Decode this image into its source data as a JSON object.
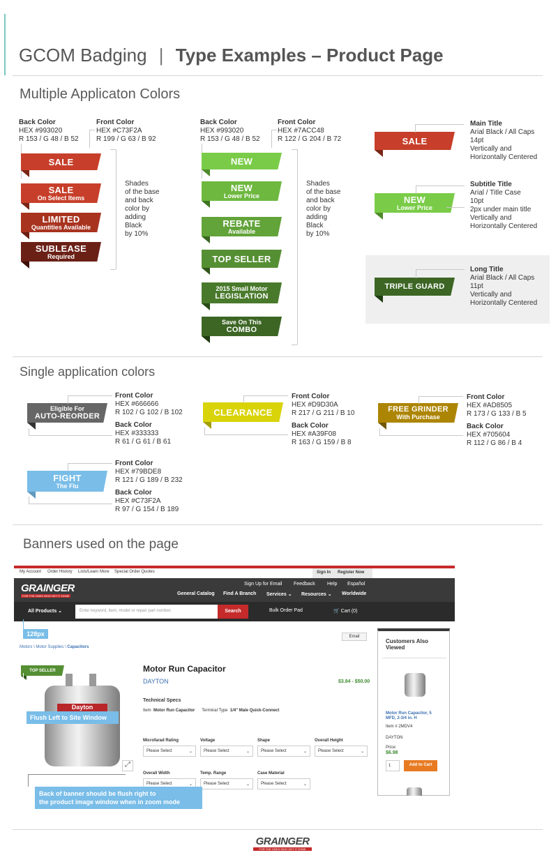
{
  "header": {
    "brand": "GCOM Badging",
    "divider": "|",
    "title": "Type Examples – Product Page"
  },
  "section1": {
    "title": "Multiple Applicaton Colors",
    "red": {
      "back": {
        "label": "Back Color",
        "hex": "HEX #993020",
        "rgb": "R 153 / G 48 / B 52"
      },
      "front": {
        "label": "Front Color",
        "hex": "HEX #C73F2A",
        "rgb": "R 199 / G 63 / B 92"
      },
      "shades": [
        "Shades",
        "of the base",
        "and back",
        "color by",
        "adding",
        "Black",
        "by 10%"
      ],
      "badges": [
        {
          "t1": "SALE",
          "t2": ""
        },
        {
          "t1": "SALE",
          "t2": "On Select Items"
        },
        {
          "t1": "LIMITED",
          "t2": "Quantities Available"
        },
        {
          "t1": "SUBLEASE",
          "t2": "Required"
        }
      ]
    },
    "green": {
      "back": {
        "label": "Back Color",
        "hex": "HEX #993020",
        "rgb": "R 153 / G 48 / B 52"
      },
      "front": {
        "label": "Front Color",
        "hex": "HEX #7ACC48",
        "rgb": "R 122 / G 204 / B 72"
      },
      "shades": [
        "Shades",
        "of the base",
        "and back",
        "color by",
        "adding",
        "Black",
        "by 10%"
      ],
      "badges": [
        {
          "t1": "NEW",
          "t2": ""
        },
        {
          "t1": "NEW",
          "t2": "Lower Price"
        },
        {
          "t1": "REBATE",
          "t2": "Available"
        },
        {
          "t1": "TOP SELLER",
          "t2": ""
        },
        {
          "t1": "LEGISLATION",
          "t2": "2015 Small Motor"
        },
        {
          "t1": "COMBO",
          "t2": "Save On This"
        }
      ]
    },
    "specs": {
      "main": {
        "badge": "SALE",
        "title": "Main Title",
        "lines": [
          "Arial Black / All Caps",
          "14pt",
          "Vertically and",
          "Horizontally Centered"
        ]
      },
      "subtitle": {
        "badge1": "NEW",
        "badge2": "Lower Price",
        "title": "Subtitle Title",
        "lines": [
          "Arial / Title Case",
          "10pt",
          "2px under main title",
          "Vertically and",
          "Horizontally Centered"
        ]
      },
      "long": {
        "badge": "TRIPLE GUARD",
        "title": "Long Title",
        "lines": [
          "Arial Black / All Caps",
          "11pt",
          "Vertically and",
          "Horizontally Centered"
        ]
      }
    }
  },
  "section2": {
    "title": "Single application colors",
    "items": [
      {
        "badge1": "Eligible For",
        "badge2": "AUTO-REORDER",
        "front": {
          "label": "Front Color",
          "hex": "HEX #666666",
          "rgb": "R 102 / G 102 / B 102"
        },
        "back": {
          "label": "Back Color",
          "hex": "HEX #333333",
          "rgb": "R 61 / G 61 / B 61"
        }
      },
      {
        "badge1": "CLEARANCE",
        "badge2": "",
        "front": {
          "label": "Front Color",
          "hex": "HEX #D9D30A",
          "rgb": "R 217 / G 211 / B 10"
        },
        "back": {
          "label": "Back Color",
          "hex": "HEX #A39F08",
          "rgb": "R 163 / G 159 / B 8"
        }
      },
      {
        "badge1": "FREE GRINDER",
        "badge2": "With Purchase",
        "front": {
          "label": "Front Color",
          "hex": "HEX #AD8505",
          "rgb": "R 173 / G 133 / B 5"
        },
        "back": {
          "label": "Back Color",
          "hex": "HEX #705604",
          "rgb": "R 112 / G 86 / B 4"
        }
      },
      {
        "badge1": "FIGHT",
        "badge2": "The Flu",
        "front": {
          "label": "Front Color",
          "hex": "HEX #79BDE8",
          "rgb": "R 121 / G 189 / B 232"
        },
        "back": {
          "label": "Back Color",
          "hex": "HEX #C73F2A",
          "rgb": "R 97 / G 154 / B 189"
        }
      }
    ]
  },
  "section3": {
    "title": "Banners used on the page",
    "site": {
      "util_links": [
        "My Account",
        "Order History",
        "Lists/Learn More",
        "Special Order Quotes"
      ],
      "signin": "Sign In",
      "register": "Register Now",
      "logo": "GRAINGER",
      "tagline": "FOR THE ONES WHO GET IT DONE",
      "top_links": [
        "Sign Up for Email",
        "Feedback",
        "Help",
        "Español"
      ],
      "main_links": [
        "General Catalog",
        "Find A Branch",
        "Services ⌄",
        "Resources ⌄",
        "Worldwide"
      ],
      "all_products": "All Products ⌄",
      "search_placeholder": "Enter keyword, item, model or repair part number.",
      "search_btn": "Search",
      "bulk": "Bulk Order Pad",
      "cart": "Cart (0)",
      "email": "Email",
      "breadcrumb": [
        "Motors",
        "Motor Supplies",
        "Capacitors"
      ],
      "badge": "TOP SELLER",
      "product_title": "Motor Run Capacitor",
      "brand": "DAYTON",
      "price": "$3.84 - $50.00",
      "tech_specs": "Technical Specs",
      "item_label": "Item",
      "item_value": "Motor Run Capacitor",
      "terminal_label": "Terminal Type",
      "terminal_value": "1/4\" Male Quick-Connect",
      "filters_row1": [
        "Microfarad Rating",
        "Voltage",
        "Shape",
        "Overall Height"
      ],
      "filters_row2": [
        "Overall Width",
        "Temp. Range",
        "Case Material"
      ],
      "select_text": "Please Select",
      "product_label": "Dayton",
      "also_viewed": "Customers Also Viewed",
      "side_product": "Motor Run Capacitor, 5 MFD, 2-3/4 in. H",
      "side_item": "Item # 2MDV4",
      "side_brand": "DAYTON",
      "side_price_label": "Price:",
      "side_price": "$6.98",
      "side_qty": "1",
      "add_to_cart": "Add to Cart"
    },
    "note_128": "128px",
    "note_flush_left": "Flush Left to Site Window",
    "note_flush_right_1": "Back of banner should be flush right to",
    "note_flush_right_2": "the product image window when in zoom mode"
  },
  "footer": {
    "logo": "GRAINGER",
    "tagline": "FOR THE ONES WHO GET IT DONE"
  },
  "colors": {
    "red_front": "#C73F2A",
    "red_back": "#993020",
    "green_front": "#7ACC48",
    "green_back": "#4f8a2a",
    "gray_front": "#666666",
    "gray_back": "#333333",
    "yellow_front": "#D9D30A",
    "yellow_back": "#A39F08",
    "gold_front": "#AD8505",
    "gold_back": "#705604",
    "blue_front": "#79BDE8",
    "blue_back": "#619ABD"
  }
}
